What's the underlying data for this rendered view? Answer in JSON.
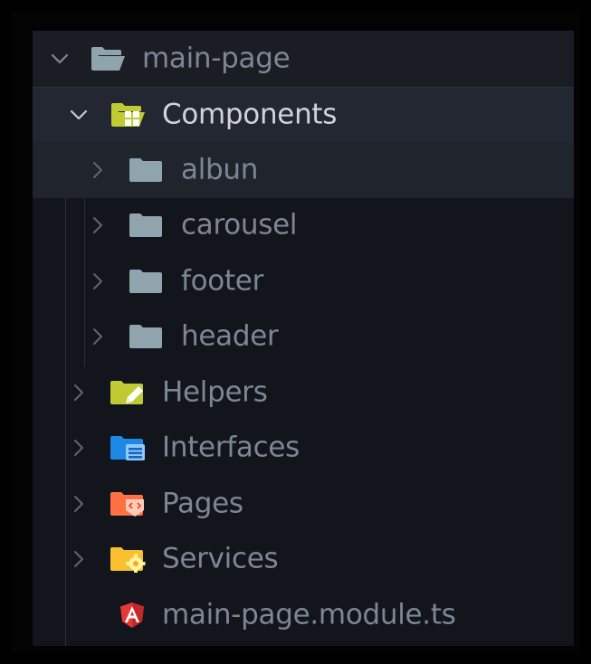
{
  "explorer": {
    "root": {
      "label": "main-page",
      "icon": "folder-open-icon",
      "expanded": true
    },
    "components": {
      "label": "Components",
      "icon": "folder-components-open-icon",
      "expanded": true
    },
    "component_children": [
      {
        "label": "albun",
        "icon": "folder-icon"
      },
      {
        "label": "carousel",
        "icon": "folder-icon"
      },
      {
        "label": "footer",
        "icon": "folder-icon"
      },
      {
        "label": "header",
        "icon": "folder-icon"
      }
    ],
    "folders": [
      {
        "label": "Helpers",
        "icon": "folder-helper-icon"
      },
      {
        "label": "Interfaces",
        "icon": "folder-interface-icon"
      },
      {
        "label": "Pages",
        "icon": "folder-views-icon"
      },
      {
        "label": "Services",
        "icon": "folder-services-icon"
      }
    ],
    "module_file": {
      "label": "main-page.module.ts",
      "icon": "angular-icon"
    }
  },
  "colors": {
    "panel_bg": "#12151c",
    "plain_folder": "#90a4ae",
    "helper_folder": "#c0ca33",
    "interface_folder": "#1e88e5",
    "views_folder": "#ff7043",
    "services_folder": "#fbc02d",
    "components_folder": "#c0ca33",
    "angular_red": "#e53935"
  }
}
